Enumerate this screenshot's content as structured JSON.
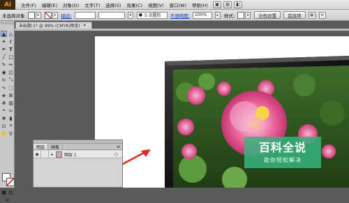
{
  "app": {
    "logo": "Ai"
  },
  "menu": [
    "文件(F)",
    "编辑(E)",
    "对象(O)",
    "文字(T)",
    "选择(S)",
    "效果(C)",
    "视图(V)",
    "窗口(W)",
    "帮助(H)"
  ],
  "control_bar": {
    "selection_label": "未选择对象",
    "stroke_label": "描边:",
    "stroke_value": "5 点圆形",
    "opacity_link": "不透明度:",
    "opacity_value": "100%",
    "style_label": "样式:",
    "doc_setup_button": "文档设置",
    "preferences_button": "首选项"
  },
  "document_tab": {
    "title": "未标题-1* @ 99% (CMYK/预览)"
  },
  "layers_panel": {
    "tabs": [
      "图层",
      "画板"
    ],
    "layer_name": "图层 1"
  },
  "watermark": {
    "title": "百科全说",
    "subtitle": "助你轻松解决"
  },
  "icons": [
    "selection-tool-icon",
    "direct-selection-tool-icon",
    "magic-wand-icon",
    "lasso-icon",
    "pen-tool-icon",
    "type-tool-icon",
    "line-tool-icon",
    "rectangle-tool-icon",
    "paintbrush-icon",
    "pencil-icon",
    "rotate-icon",
    "scale-icon",
    "warp-icon",
    "free-transform-icon",
    "symbol-sprayer-icon",
    "graph-icon",
    "mesh-icon",
    "gradient-icon",
    "eyedropper-icon",
    "blend-icon",
    "slice-icon",
    "eraser-icon",
    "hand-icon",
    "zoom-icon",
    "eye-icon",
    "lock-icon"
  ],
  "colors": {
    "accent_arrow": "#e02a20",
    "watermark_bg": "#36b37e",
    "app_logo": "#f7941d"
  }
}
